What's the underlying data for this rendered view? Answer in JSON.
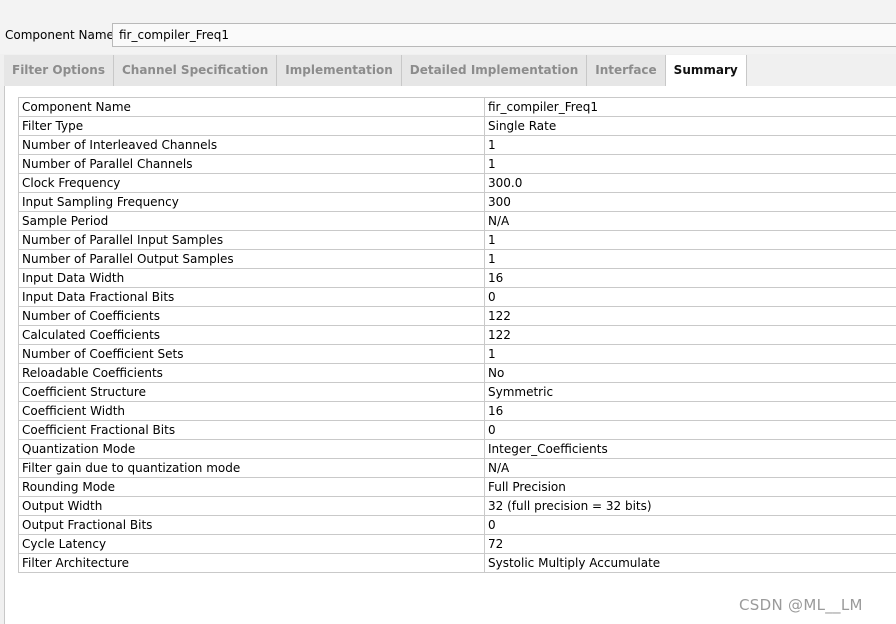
{
  "component_name": {
    "label": "Component Name",
    "value": "fir_compiler_Freq1"
  },
  "tabs": [
    {
      "label": "Filter Options",
      "active": false
    },
    {
      "label": "Channel Specification",
      "active": false
    },
    {
      "label": "Implementation",
      "active": false
    },
    {
      "label": "Detailed Implementation",
      "active": false
    },
    {
      "label": "Interface",
      "active": false
    },
    {
      "label": "Summary",
      "active": true
    }
  ],
  "summary": {
    "rows": [
      {
        "key": "Component Name",
        "value": "fir_compiler_Freq1"
      },
      {
        "key": "Filter Type",
        "value": "Single Rate"
      },
      {
        "key": "Number of Interleaved Channels",
        "value": "1"
      },
      {
        "key": "Number of Parallel Channels",
        "value": "1"
      },
      {
        "key": "Clock Frequency",
        "value": "300.0"
      },
      {
        "key": "Input Sampling Frequency",
        "value": "300"
      },
      {
        "key": "Sample Period",
        "value": "N/A"
      },
      {
        "key": "Number of Parallel Input Samples",
        "value": "1"
      },
      {
        "key": "Number of Parallel Output Samples",
        "value": "1"
      },
      {
        "key": "Input Data Width",
        "value": "16"
      },
      {
        "key": "Input Data Fractional Bits",
        "value": "0"
      },
      {
        "key": "Number of Coefficients",
        "value": "122"
      },
      {
        "key": "Calculated Coefficients",
        "value": "122"
      },
      {
        "key": "Number of Coefficient Sets",
        "value": "1"
      },
      {
        "key": "Reloadable Coefficients",
        "value": "No"
      },
      {
        "key": "Coefficient Structure",
        "value": "Symmetric"
      },
      {
        "key": "Coefficient Width",
        "value": "16"
      },
      {
        "key": "Coefficient Fractional Bits",
        "value": "0"
      },
      {
        "key": "Quantization Mode",
        "value": "Integer_Coefficients"
      },
      {
        "key": "Filter gain due to quantization mode",
        "value": "N/A"
      },
      {
        "key": "Rounding Mode",
        "value": "Full Precision"
      },
      {
        "key": "Output Width",
        "value": "32 (full precision = 32 bits)"
      },
      {
        "key": "Output Fractional Bits",
        "value": "0"
      },
      {
        "key": "Cycle Latency",
        "value": "72"
      },
      {
        "key": "Filter Architecture",
        "value": "Systolic Multiply Accumulate"
      }
    ]
  },
  "watermark": "CSDN @ML__LM"
}
